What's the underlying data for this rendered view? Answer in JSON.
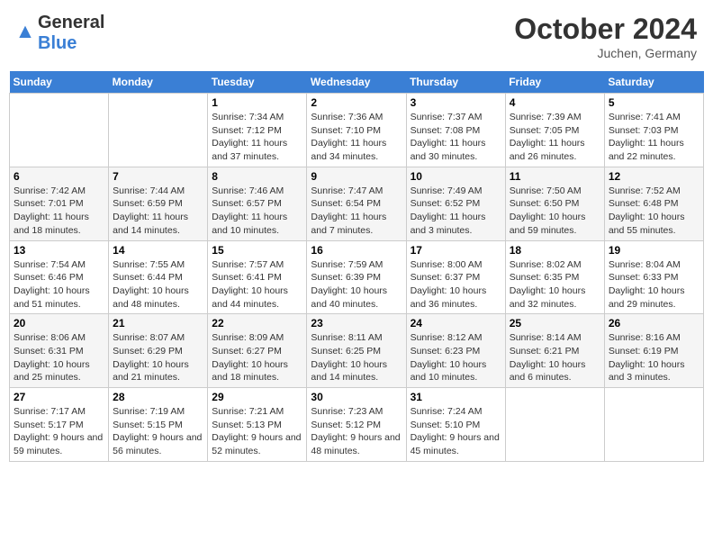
{
  "header": {
    "logo_general": "General",
    "logo_blue": "Blue",
    "month_title": "October 2024",
    "location": "Juchen, Germany"
  },
  "weekdays": [
    "Sunday",
    "Monday",
    "Tuesday",
    "Wednesday",
    "Thursday",
    "Friday",
    "Saturday"
  ],
  "weeks": [
    [
      {
        "day": "",
        "sunrise": "",
        "sunset": "",
        "daylight": ""
      },
      {
        "day": "",
        "sunrise": "",
        "sunset": "",
        "daylight": ""
      },
      {
        "day": "1",
        "sunrise": "Sunrise: 7:34 AM",
        "sunset": "Sunset: 7:12 PM",
        "daylight": "Daylight: 11 hours and 37 minutes."
      },
      {
        "day": "2",
        "sunrise": "Sunrise: 7:36 AM",
        "sunset": "Sunset: 7:10 PM",
        "daylight": "Daylight: 11 hours and 34 minutes."
      },
      {
        "day": "3",
        "sunrise": "Sunrise: 7:37 AM",
        "sunset": "Sunset: 7:08 PM",
        "daylight": "Daylight: 11 hours and 30 minutes."
      },
      {
        "day": "4",
        "sunrise": "Sunrise: 7:39 AM",
        "sunset": "Sunset: 7:05 PM",
        "daylight": "Daylight: 11 hours and 26 minutes."
      },
      {
        "day": "5",
        "sunrise": "Sunrise: 7:41 AM",
        "sunset": "Sunset: 7:03 PM",
        "daylight": "Daylight: 11 hours and 22 minutes."
      }
    ],
    [
      {
        "day": "6",
        "sunrise": "Sunrise: 7:42 AM",
        "sunset": "Sunset: 7:01 PM",
        "daylight": "Daylight: 11 hours and 18 minutes."
      },
      {
        "day": "7",
        "sunrise": "Sunrise: 7:44 AM",
        "sunset": "Sunset: 6:59 PM",
        "daylight": "Daylight: 11 hours and 14 minutes."
      },
      {
        "day": "8",
        "sunrise": "Sunrise: 7:46 AM",
        "sunset": "Sunset: 6:57 PM",
        "daylight": "Daylight: 11 hours and 10 minutes."
      },
      {
        "day": "9",
        "sunrise": "Sunrise: 7:47 AM",
        "sunset": "Sunset: 6:54 PM",
        "daylight": "Daylight: 11 hours and 7 minutes."
      },
      {
        "day": "10",
        "sunrise": "Sunrise: 7:49 AM",
        "sunset": "Sunset: 6:52 PM",
        "daylight": "Daylight: 11 hours and 3 minutes."
      },
      {
        "day": "11",
        "sunrise": "Sunrise: 7:50 AM",
        "sunset": "Sunset: 6:50 PM",
        "daylight": "Daylight: 10 hours and 59 minutes."
      },
      {
        "day": "12",
        "sunrise": "Sunrise: 7:52 AM",
        "sunset": "Sunset: 6:48 PM",
        "daylight": "Daylight: 10 hours and 55 minutes."
      }
    ],
    [
      {
        "day": "13",
        "sunrise": "Sunrise: 7:54 AM",
        "sunset": "Sunset: 6:46 PM",
        "daylight": "Daylight: 10 hours and 51 minutes."
      },
      {
        "day": "14",
        "sunrise": "Sunrise: 7:55 AM",
        "sunset": "Sunset: 6:44 PM",
        "daylight": "Daylight: 10 hours and 48 minutes."
      },
      {
        "day": "15",
        "sunrise": "Sunrise: 7:57 AM",
        "sunset": "Sunset: 6:41 PM",
        "daylight": "Daylight: 10 hours and 44 minutes."
      },
      {
        "day": "16",
        "sunrise": "Sunrise: 7:59 AM",
        "sunset": "Sunset: 6:39 PM",
        "daylight": "Daylight: 10 hours and 40 minutes."
      },
      {
        "day": "17",
        "sunrise": "Sunrise: 8:00 AM",
        "sunset": "Sunset: 6:37 PM",
        "daylight": "Daylight: 10 hours and 36 minutes."
      },
      {
        "day": "18",
        "sunrise": "Sunrise: 8:02 AM",
        "sunset": "Sunset: 6:35 PM",
        "daylight": "Daylight: 10 hours and 32 minutes."
      },
      {
        "day": "19",
        "sunrise": "Sunrise: 8:04 AM",
        "sunset": "Sunset: 6:33 PM",
        "daylight": "Daylight: 10 hours and 29 minutes."
      }
    ],
    [
      {
        "day": "20",
        "sunrise": "Sunrise: 8:06 AM",
        "sunset": "Sunset: 6:31 PM",
        "daylight": "Daylight: 10 hours and 25 minutes."
      },
      {
        "day": "21",
        "sunrise": "Sunrise: 8:07 AM",
        "sunset": "Sunset: 6:29 PM",
        "daylight": "Daylight: 10 hours and 21 minutes."
      },
      {
        "day": "22",
        "sunrise": "Sunrise: 8:09 AM",
        "sunset": "Sunset: 6:27 PM",
        "daylight": "Daylight: 10 hours and 18 minutes."
      },
      {
        "day": "23",
        "sunrise": "Sunrise: 8:11 AM",
        "sunset": "Sunset: 6:25 PM",
        "daylight": "Daylight: 10 hours and 14 minutes."
      },
      {
        "day": "24",
        "sunrise": "Sunrise: 8:12 AM",
        "sunset": "Sunset: 6:23 PM",
        "daylight": "Daylight: 10 hours and 10 minutes."
      },
      {
        "day": "25",
        "sunrise": "Sunrise: 8:14 AM",
        "sunset": "Sunset: 6:21 PM",
        "daylight": "Daylight: 10 hours and 6 minutes."
      },
      {
        "day": "26",
        "sunrise": "Sunrise: 8:16 AM",
        "sunset": "Sunset: 6:19 PM",
        "daylight": "Daylight: 10 hours and 3 minutes."
      }
    ],
    [
      {
        "day": "27",
        "sunrise": "Sunrise: 7:17 AM",
        "sunset": "Sunset: 5:17 PM",
        "daylight": "Daylight: 9 hours and 59 minutes."
      },
      {
        "day": "28",
        "sunrise": "Sunrise: 7:19 AM",
        "sunset": "Sunset: 5:15 PM",
        "daylight": "Daylight: 9 hours and 56 minutes."
      },
      {
        "day": "29",
        "sunrise": "Sunrise: 7:21 AM",
        "sunset": "Sunset: 5:13 PM",
        "daylight": "Daylight: 9 hours and 52 minutes."
      },
      {
        "day": "30",
        "sunrise": "Sunrise: 7:23 AM",
        "sunset": "Sunset: 5:12 PM",
        "daylight": "Daylight: 9 hours and 48 minutes."
      },
      {
        "day": "31",
        "sunrise": "Sunrise: 7:24 AM",
        "sunset": "Sunset: 5:10 PM",
        "daylight": "Daylight: 9 hours and 45 minutes."
      },
      {
        "day": "",
        "sunrise": "",
        "sunset": "",
        "daylight": ""
      },
      {
        "day": "",
        "sunrise": "",
        "sunset": "",
        "daylight": ""
      }
    ]
  ]
}
